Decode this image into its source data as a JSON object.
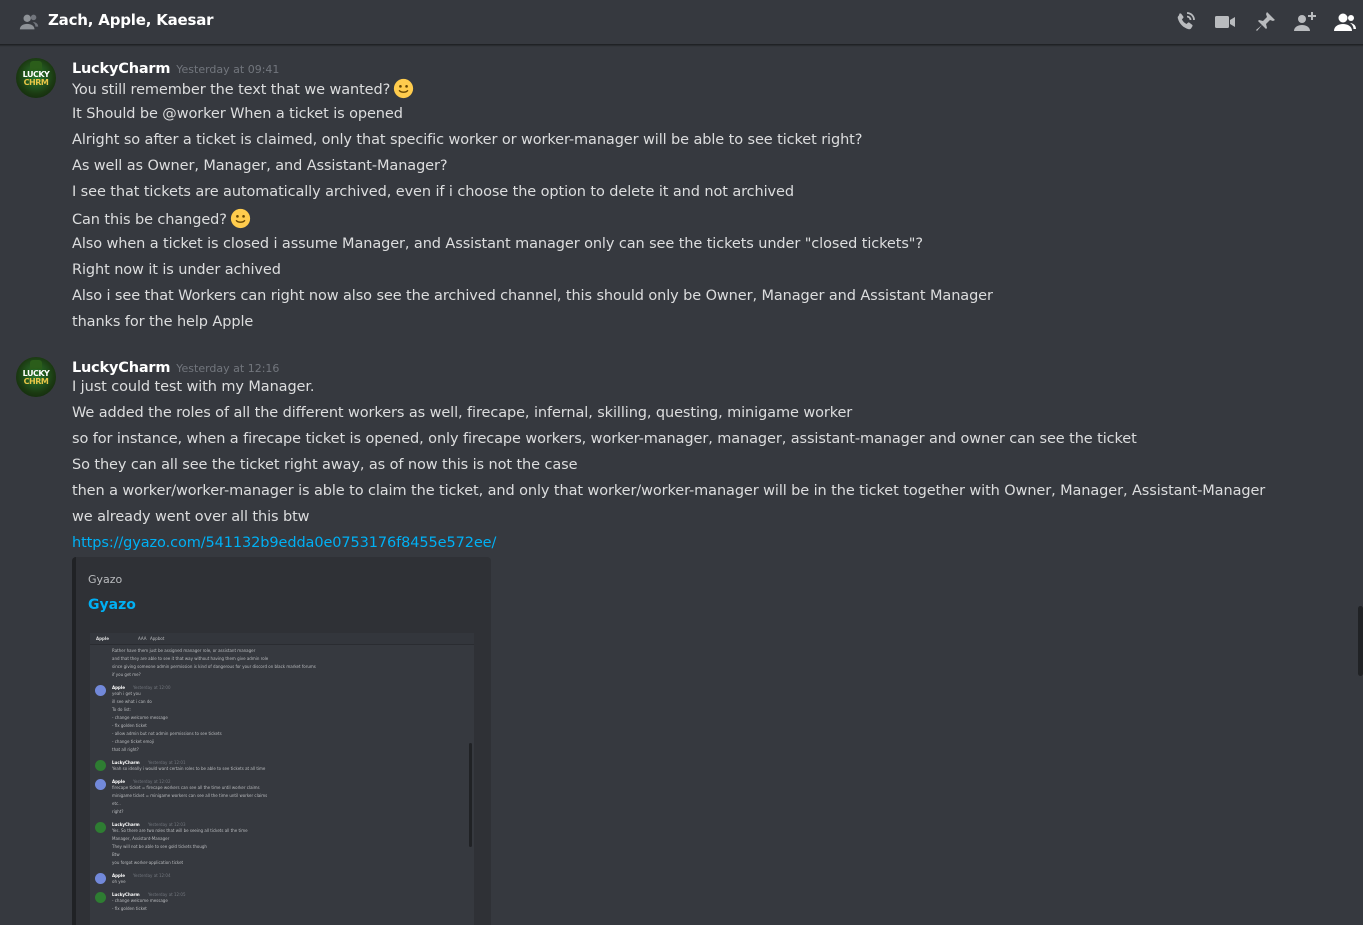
{
  "header": {
    "title": "Zach, Apple, Kaesar",
    "icons": [
      "people-icon",
      "call-icon",
      "video-icon",
      "pin-icon",
      "add-friend-icon",
      "member-list-icon"
    ]
  },
  "messages": [
    {
      "author": "LuckyCharm",
      "timestamp": "Yesterday at 09:41",
      "lines": [
        "You still remember the text that we wanted?",
        "It Should be @worker When a ticket is opened",
        "Alright so after a ticket is claimed, only that specific worker or worker-manager will be able to see ticket right?",
        "As well as Owner, Manager, and Assistant-Manager?",
        "I see that tickets are automatically archived, even if i choose the option to delete it and not archived",
        "Can this be changed?",
        "Also when a ticket is closed i assume Manager, and Assistant manager only can see the tickets under \"closed tickets\"?",
        "Right now it is under achived",
        "Also i see that Workers can right now also see the archived channel, this should only be Owner, Manager and Assistant Manager",
        "thanks for the help Apple"
      ]
    },
    {
      "author": "LuckyCharm",
      "timestamp": "Yesterday at 12:16",
      "lines": [
        "I just could test with my Manager.",
        "We added the roles of all the different workers as well, firecape, infernal, skilling, questing, minigame worker",
        "so for instance, when a firecape ticket is opened, only firecape workers, worker-manager, manager, assistant-manager and owner can see the ticket",
        "So they can all see the ticket right away, as of now this is not the case",
        "then a worker/worker-manager is able to claim the ticket, and only that worker/worker-manager will be in the ticket together with Owner, Manager, Assistant-Manager",
        "we already went over all this btw"
      ],
      "link": "https://gyazo.com/541132b9edda0e0753176f8455e572ee/",
      "embed": {
        "provider": "Gyazo",
        "title": "Gyazo"
      }
    }
  ],
  "avatar_text": [
    "LUCKY",
    "CHRM"
  ],
  "embed_preview": {
    "header_name": "Apple",
    "header_tag": "AAA",
    "header_app": "Appbot",
    "lines": [
      {
        "kind": "text",
        "text": "Rather have them just be assigned manager role, or assistant manager"
      },
      {
        "kind": "text",
        "text": "and that they are able to see it that way without having them give admin role"
      },
      {
        "kind": "text",
        "text": "since giving someone admin permission is kind of dangerous for your discord on black market forums"
      },
      {
        "kind": "text",
        "text": "if you get me?"
      },
      {
        "kind": "name",
        "text": "Apple",
        "time": "Yesterday at 12:00",
        "av": "apple"
      },
      {
        "kind": "text",
        "text": "yeah i get you"
      },
      {
        "kind": "text",
        "text": "ill see what i can do"
      },
      {
        "kind": "text",
        "text": "To do list:"
      },
      {
        "kind": "text",
        "text": "- change welcome message"
      },
      {
        "kind": "text",
        "text": "- fix golden ticket"
      },
      {
        "kind": "text",
        "text": "- allow admin but not admin permissions to see tickets"
      },
      {
        "kind": "text",
        "text": "- change ticket emoji"
      },
      {
        "kind": "text",
        "text": "that all right?"
      },
      {
        "kind": "name",
        "text": "LuckyCharm",
        "time": "Yesterday at 12:01",
        "av": "lucky"
      },
      {
        "kind": "text",
        "text": "Yeah so ideally i would want certain roles to be able to see tickets at all time"
      },
      {
        "kind": "name",
        "text": "Apple",
        "time": "Yesterday at 12:02",
        "av": "apple"
      },
      {
        "kind": "text",
        "text": "firecape ticket = firecape workers can see all the time until worker claims"
      },
      {
        "kind": "text",
        "text": "minigame ticket = minigame workers can see all the time until worker claims"
      },
      {
        "kind": "text",
        "text": "etc.."
      },
      {
        "kind": "text",
        "text": "right?"
      },
      {
        "kind": "name",
        "text": "LuckyCharm",
        "time": "Yesterday at 12:03",
        "av": "lucky"
      },
      {
        "kind": "text",
        "text": "Yes. So there are two roles that will be seeing all tickets all the time"
      },
      {
        "kind": "text",
        "text": "Manager, Assistant-Manager"
      },
      {
        "kind": "text",
        "text": "They will not be able to see gold tickets though"
      },
      {
        "kind": "text",
        "text": "Btw"
      },
      {
        "kind": "text",
        "text": "you forgot worker-application ticket"
      },
      {
        "kind": "name",
        "text": "Apple",
        "time": "Yesterday at 12:04",
        "av": "apple"
      },
      {
        "kind": "text",
        "text": "oh yee"
      },
      {
        "kind": "name",
        "text": "LuckyCharm",
        "time": "Yesterday at 12:05",
        "av": "lucky"
      },
      {
        "kind": "text",
        "text": "- change welcome message"
      },
      {
        "kind": "text",
        "text": "- fix golden ticket"
      }
    ]
  },
  "colors": {
    "background": "#36393f",
    "header_text": "#ffffff",
    "message_text": "#dcddde",
    "timestamp": "#72767d",
    "link": "#00b0f4",
    "embed_bg": "#2f3136",
    "icon": "#b9bbbe"
  }
}
